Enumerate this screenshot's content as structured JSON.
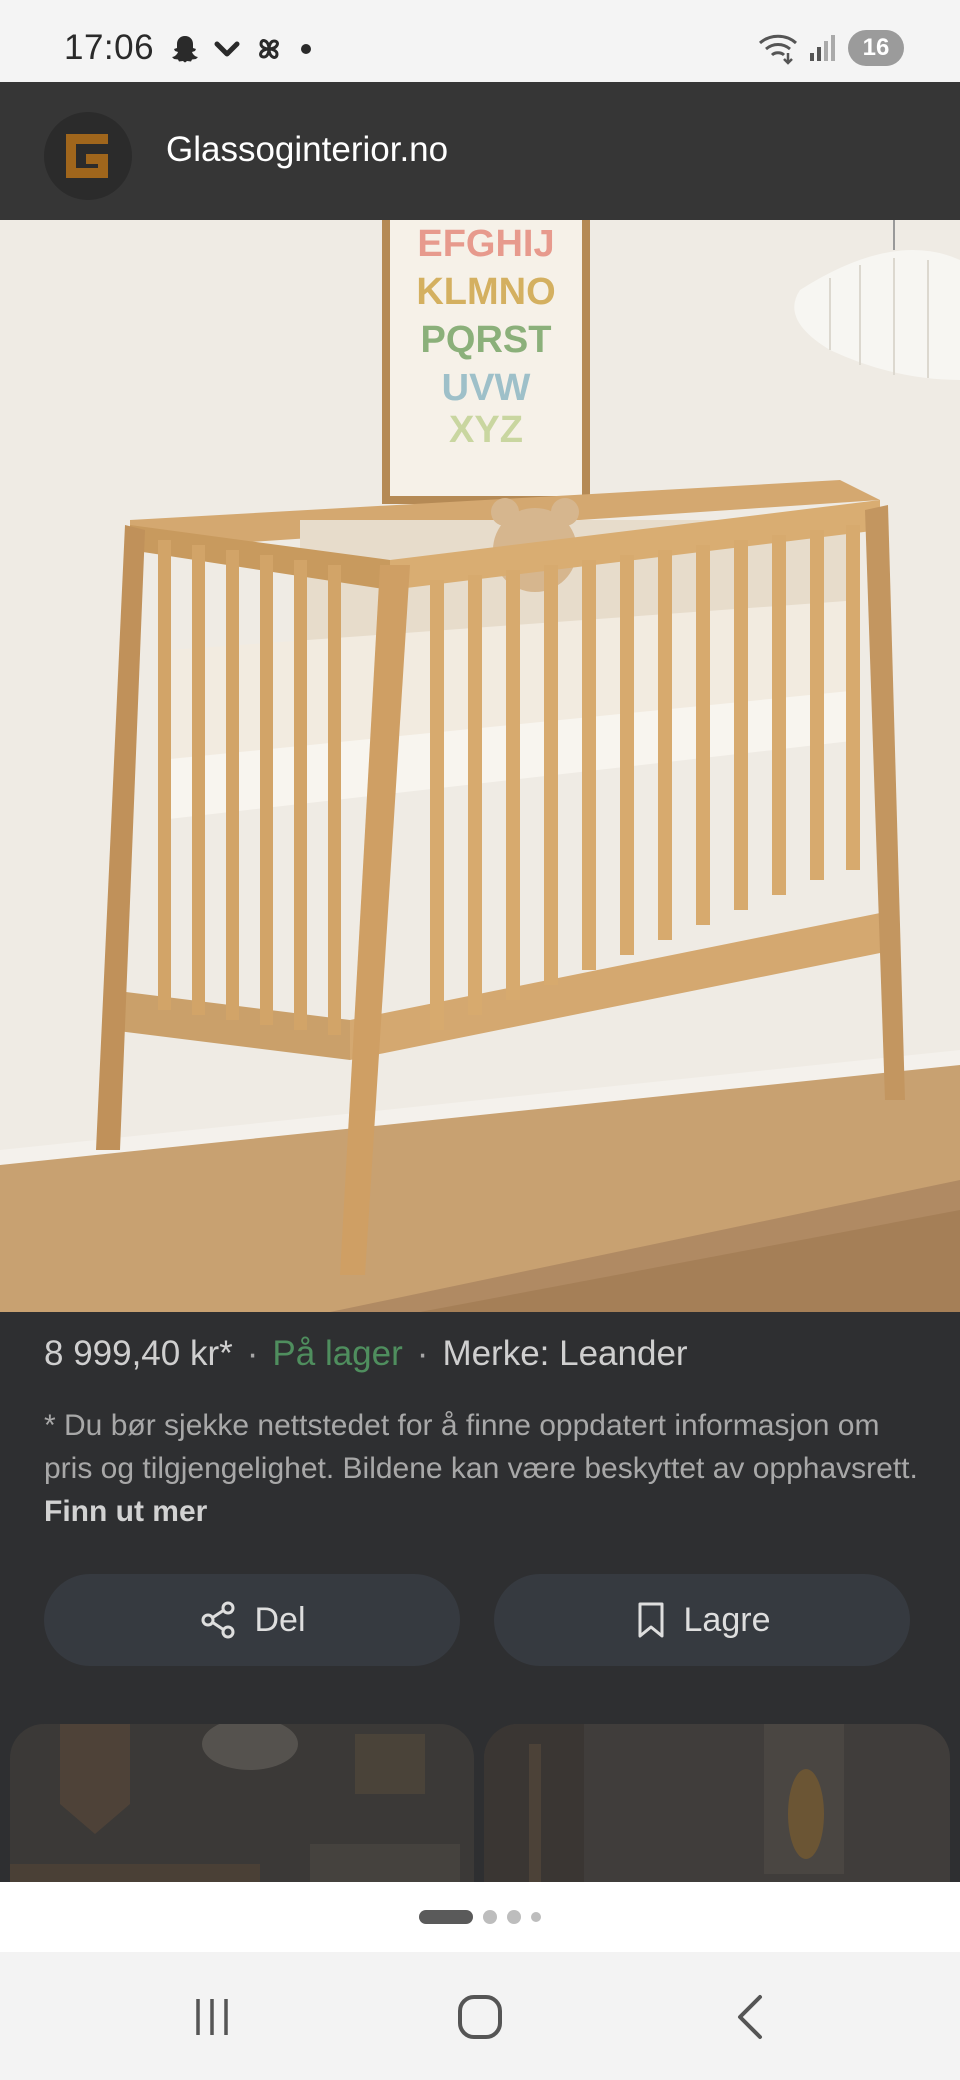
{
  "status_bar": {
    "time": "17:06",
    "left_icons": [
      "snapchat-icon",
      "chevron-down-icon",
      "pinwheel-icon",
      "dot-icon"
    ],
    "right_icons": [
      "wifi-icon",
      "signal-icon"
    ],
    "battery": "16"
  },
  "header": {
    "site_name": "Glassoginterior.no",
    "logo_letter": "G"
  },
  "product": {
    "image_icon": "crib-photo",
    "poster_letters": [
      "EFGHIJ",
      "KLMNO",
      "PQRST",
      "UVW",
      "XYZ"
    ],
    "price": "8 999,40 kr*",
    "separator": "·",
    "stock": "På lager",
    "brand": "Merke: Leander",
    "disclaimer": "* Du bør sjekke nettstedet for å finne oppdatert informasjon om pris og tilgjengelighet. Bildene kan være beskyttet av opphavsrett.",
    "learn_more": "Finn ut mer"
  },
  "actions": {
    "share_label": "Del",
    "save_label": "Lagre"
  },
  "pager": {
    "pages": 4,
    "active": 1
  },
  "nav": [
    "recent-apps-icon",
    "home-icon",
    "back-icon"
  ],
  "colors": {
    "stock_green": "#4f8e5e",
    "overlay": "#2e2f31"
  }
}
